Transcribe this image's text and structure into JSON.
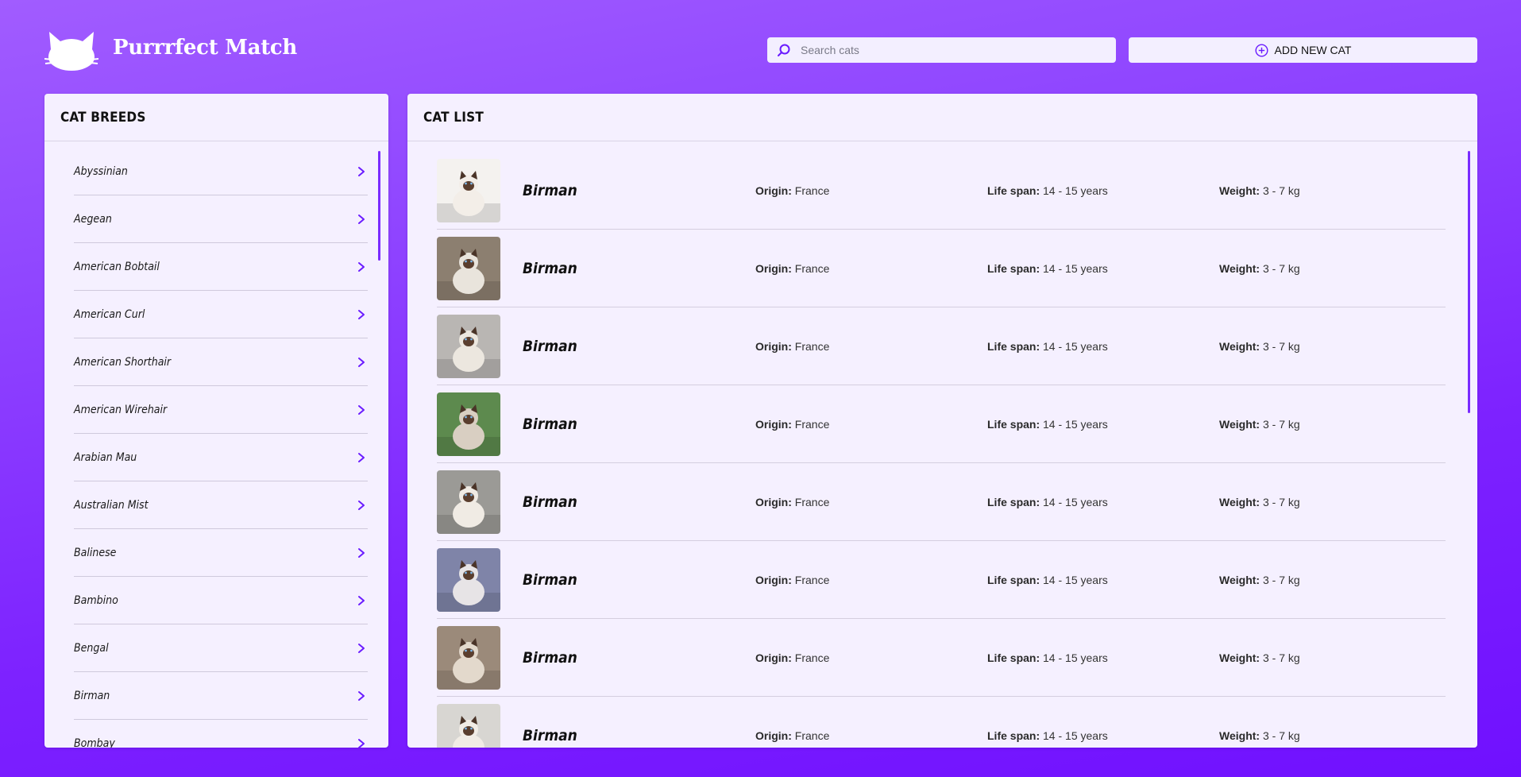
{
  "header": {
    "brand": "Purrrfect Match",
    "search_placeholder": "Search cats",
    "add_button_label": "ADD NEW CAT"
  },
  "breeds_panel": {
    "title": "CAT BREEDS",
    "items": [
      "Abyssinian",
      "Aegean",
      "American Bobtail",
      "American Curl",
      "American Shorthair",
      "American Wirehair",
      "Arabian Mau",
      "Australian Mist",
      "Balinese",
      "Bambino",
      "Bengal",
      "Birman",
      "Bombay"
    ]
  },
  "cat_list_panel": {
    "title": "CAT LIST",
    "labels": {
      "origin": "Origin:",
      "life_span": "Life span:",
      "weight": "Weight:"
    },
    "rows": [
      {
        "name": "Birman",
        "origin": "France",
        "life_span": "14 - 15 years",
        "weight": "3 - 7 kg"
      },
      {
        "name": "Birman",
        "origin": "France",
        "life_span": "14 - 15 years",
        "weight": "3 - 7 kg"
      },
      {
        "name": "Birman",
        "origin": "France",
        "life_span": "14 - 15 years",
        "weight": "3 - 7 kg"
      },
      {
        "name": "Birman",
        "origin": "France",
        "life_span": "14 - 15 years",
        "weight": "3 - 7 kg"
      },
      {
        "name": "Birman",
        "origin": "France",
        "life_span": "14 - 15 years",
        "weight": "3 - 7 kg"
      },
      {
        "name": "Birman",
        "origin": "France",
        "life_span": "14 - 15 years",
        "weight": "3 - 7 kg"
      },
      {
        "name": "Birman",
        "origin": "France",
        "life_span": "14 - 15 years",
        "weight": "3 - 7 kg"
      },
      {
        "name": "Birman",
        "origin": "France",
        "life_span": "14 - 15 years",
        "weight": "3 - 7 kg"
      }
    ]
  },
  "colors": {
    "accent": "#7a2bff",
    "panel_bg": "#f5f0ff"
  }
}
